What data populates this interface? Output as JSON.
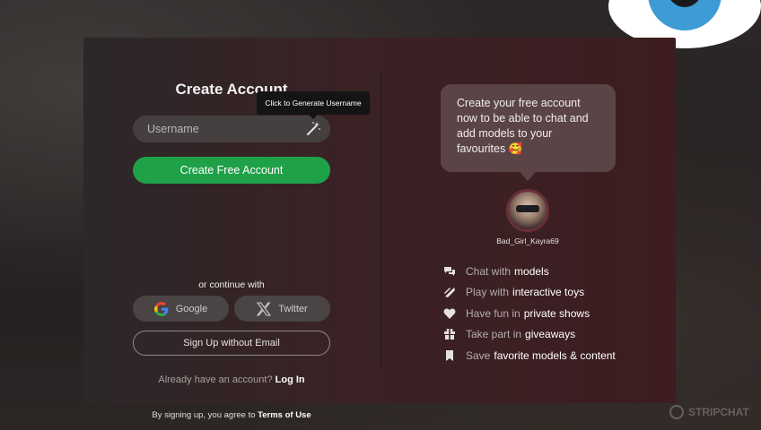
{
  "left": {
    "title": "Create Account",
    "tooltip": "Click to Generate Username",
    "username_placeholder": "Username",
    "create_button": "Create Free Account",
    "continue_with": "or continue with",
    "google_label": "Google",
    "twitter_label": "Twitter",
    "no_email_button": "Sign Up without Email",
    "already_text": "Already have an account?",
    "login_link": "Log In"
  },
  "terms": {
    "prefix": "By signing up, you agree to",
    "link": "Terms of Use"
  },
  "right": {
    "bubble_text": "Create your free account now to be able to chat and add models to your favourites 🥰",
    "model_name": "Bad_Girl_Kayra69",
    "features": [
      {
        "icon": "chat-icon",
        "muted": "Chat with",
        "highlight": "models"
      },
      {
        "icon": "toys-icon",
        "muted": "Play with",
        "highlight": "interactive toys"
      },
      {
        "icon": "heart-icon",
        "muted": "Have fun in",
        "highlight": "private shows"
      },
      {
        "icon": "gift-icon",
        "muted": "Take part in",
        "highlight": "giveaways"
      },
      {
        "icon": "bookmark-icon",
        "muted": "Save",
        "highlight": "favorite models & content"
      }
    ]
  },
  "brand": {
    "watermark": "STRIPCHAT",
    "accent_green": "#1fa148",
    "eye_blue": "#3d9bd6"
  }
}
